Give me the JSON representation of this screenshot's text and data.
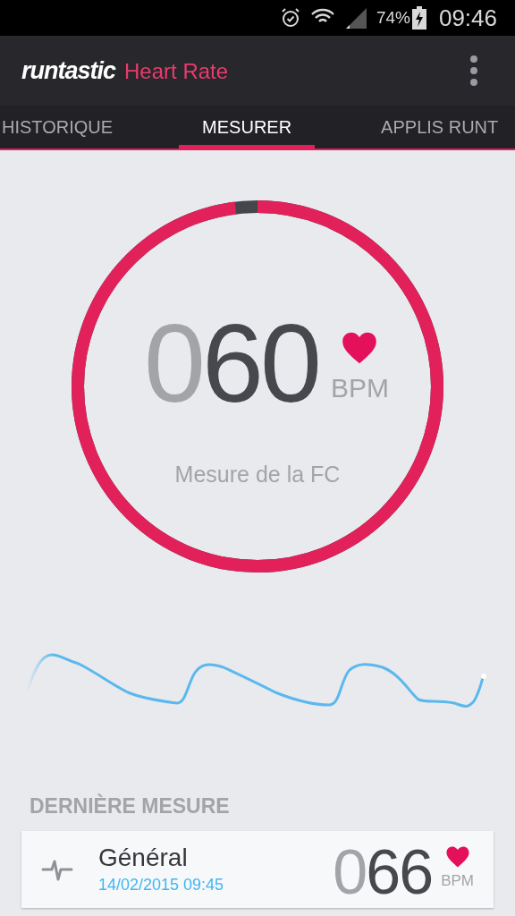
{
  "status_bar": {
    "battery": "74%",
    "time": "09:46"
  },
  "app_bar": {
    "logo": "runtastic",
    "title": "Heart Rate"
  },
  "tabs": [
    {
      "label": "HISTORIQUE",
      "selected": false
    },
    {
      "label": "MESURER",
      "selected": true
    },
    {
      "label": "APPLIS RUNT",
      "selected": false
    }
  ],
  "measure": {
    "level": 0.98,
    "leading_zeros": "0",
    "value": "60",
    "unit": "BPM",
    "caption": "Mesure de la FC"
  },
  "last_measure": {
    "heading": "DERNIÈRE MESURE",
    "name": "Général",
    "datetime": "14/02/2015 09:45",
    "leading_zeros": "0",
    "value": "66",
    "unit": "BPM"
  }
}
